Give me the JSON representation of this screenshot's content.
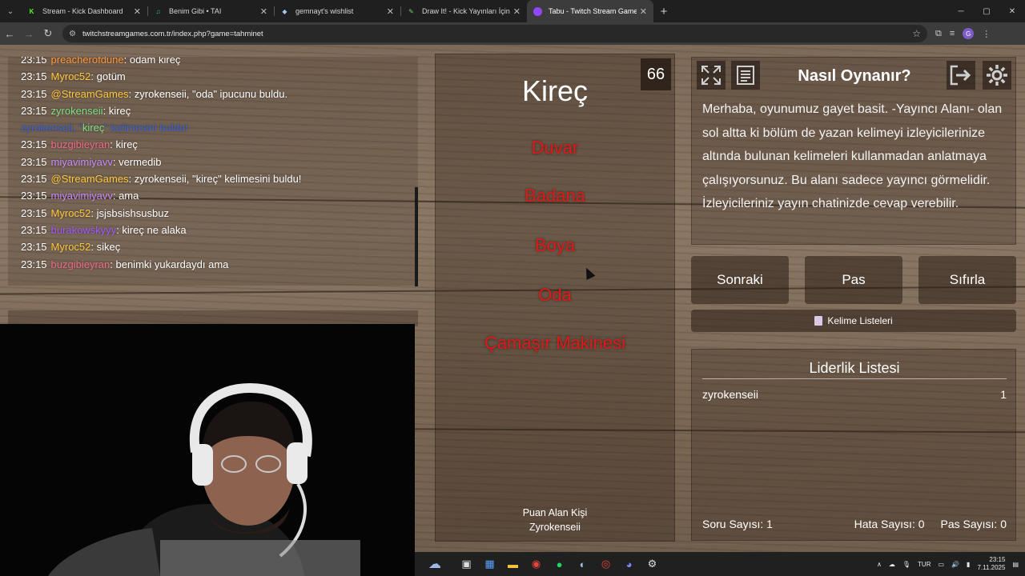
{
  "tabs": [
    {
      "title": "Stream - Kick Dashboard",
      "favicon": "K",
      "color": "#53fc18"
    },
    {
      "title": "Benim Gibi • TAI",
      "favicon": "♫",
      "color": "#1ed760"
    },
    {
      "title": "gemnayt's wishlist",
      "favicon": "◆",
      "color": "#9ec6f0"
    },
    {
      "title": "Draw It! - Kick Yayınları İçin Çizim",
      "favicon": "✎",
      "color": "#6bd36b"
    },
    {
      "title": "Tabu - Twitch Stream Games",
      "favicon": "",
      "color": "#3c3c3c",
      "active": true
    }
  ],
  "url": "twitchstreamgames.com.tr/index.php?game=tahminet",
  "profile_letter": "G",
  "chat": [
    {
      "time": "23:15",
      "user": "preacherofdune",
      "user_color": "#ff9a3d",
      "message": ": odam kireç"
    },
    {
      "time": "23:15",
      "user": "Myroc52",
      "user_color": "#ffc93d",
      "message": ": gotüm"
    },
    {
      "time": "23:15",
      "user": "@StreamGames",
      "user_color": "#ffc93d",
      "message": ": zyrokenseii, \"oda\" ipucunu buldu."
    },
    {
      "time": "23:15",
      "user": "zyrokenseii",
      "user_color": "#7fe08a",
      "message": ": kireç"
    },
    {
      "time": "",
      "user": "zyrokenseii, \"",
      "user_color": "#3a64d8",
      "highlight_word": "kireç",
      "highlight_color": "#7fe08a",
      "message": "\" kelimesini buldu!",
      "message_color": "#3a64d8"
    },
    {
      "time": "23:15",
      "user": "buzgibieyran",
      "user_color": "#f06a8a",
      "message": ": kireç"
    },
    {
      "time": "23:15",
      "user": "miyavimiyavv",
      "user_color": "#c98bff",
      "message": ": vermedib"
    },
    {
      "time": "23:15",
      "user": "@StreamGames",
      "user_color": "#ffc93d",
      "message": ": zyrokenseii, \"kireç\" kelimesini buldu!"
    },
    {
      "time": "23:15",
      "user": "miyavimiyavv",
      "user_color": "#c98bff",
      "message": ": ama"
    },
    {
      "time": "23:15",
      "user": "Myroc52",
      "user_color": "#ffc93d",
      "message": ": jsjsbsishsusbuz"
    },
    {
      "time": "23:15",
      "user": "burakowskyyy",
      "user_color": "#a05aff",
      "message": ": kireç ne alaka"
    },
    {
      "time": "23:15",
      "user": "Myroc52",
      "user_color": "#ffc93d",
      "message": ": sikeç"
    },
    {
      "time": "23:15",
      "user": "buzgibieyran",
      "user_color": "#f06a8a",
      "message": ": benimki yukardaydı ama"
    }
  ],
  "game": {
    "timer": "66",
    "main_word": "Kireç",
    "taboo_words": [
      "Duvar",
      "Badana",
      "Boya",
      "Oda",
      "Çamaşır Makinesi"
    ],
    "scorer_label": "Puan Alan Kişi",
    "scorer_name": "Zyrokenseii"
  },
  "how_to": {
    "title": "Nasıl Oynanır?",
    "text": "Merhaba, oyunumuz gayet basit. -Yayıncı Alanı- olan sol altta ki bölüm de yazan kelimeyi izleyicilerinize altında bulunan kelimeleri kullanmadan anlatmaya çalışıyorsunuz. Bu alanı sadece yayıncı görmelidir. İzleyicileriniz yayın chatinizde cevap verebilir."
  },
  "buttons": {
    "next": "Sonraki",
    "pass": "Pas",
    "reset": "Sıfırla",
    "word_lists": "Kelime Listeleri"
  },
  "leaderboard": {
    "title": "Liderlik Listesi",
    "rows": [
      {
        "name": "zyrokenseii",
        "score": "1"
      }
    ]
  },
  "stats": {
    "questions": "Soru Sayısı: 1",
    "errors": "Hata Sayısı: 0",
    "passes": "Pas Sayısı: 0"
  },
  "taskbar": {
    "lang": "TUR",
    "time": "23:15",
    "date": "7.11.2025"
  }
}
